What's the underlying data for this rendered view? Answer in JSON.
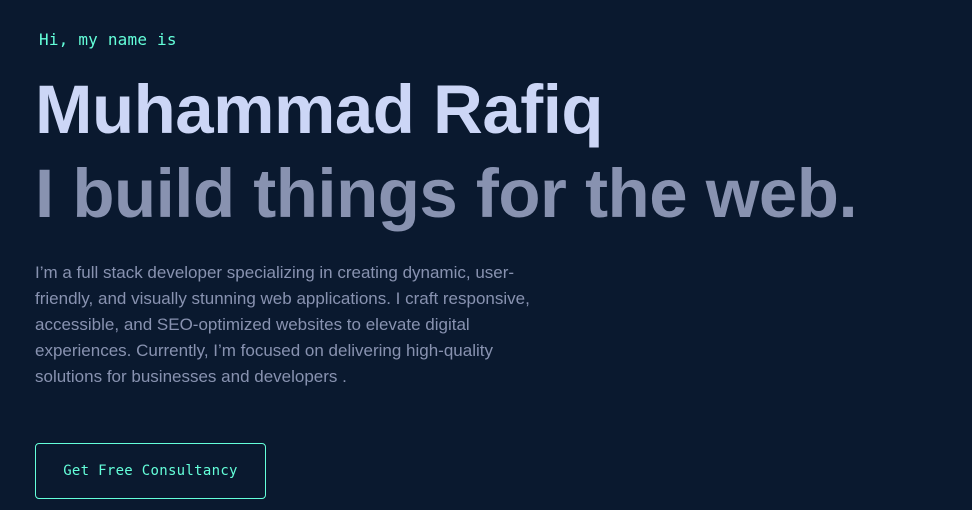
{
  "hero": {
    "greeting": "Hi, my name is",
    "name": "Muhammad Rafiq",
    "tagline": "I build things for the web.",
    "bio": "I’m a full stack developer specializing in creating dynamic, user-friendly, and visually stunning web applications. I craft responsive, accessible, and SEO-optimized websites to elevate digital experiences. Currently, I’m focused on delivering high-quality solutions for businesses and developers .",
    "cta_label": "Get Free Consultancy"
  },
  "colors": {
    "background": "#0a192f",
    "accent": "#64ffda",
    "heading": "#ccd6f6",
    "muted": "#8892b0"
  }
}
